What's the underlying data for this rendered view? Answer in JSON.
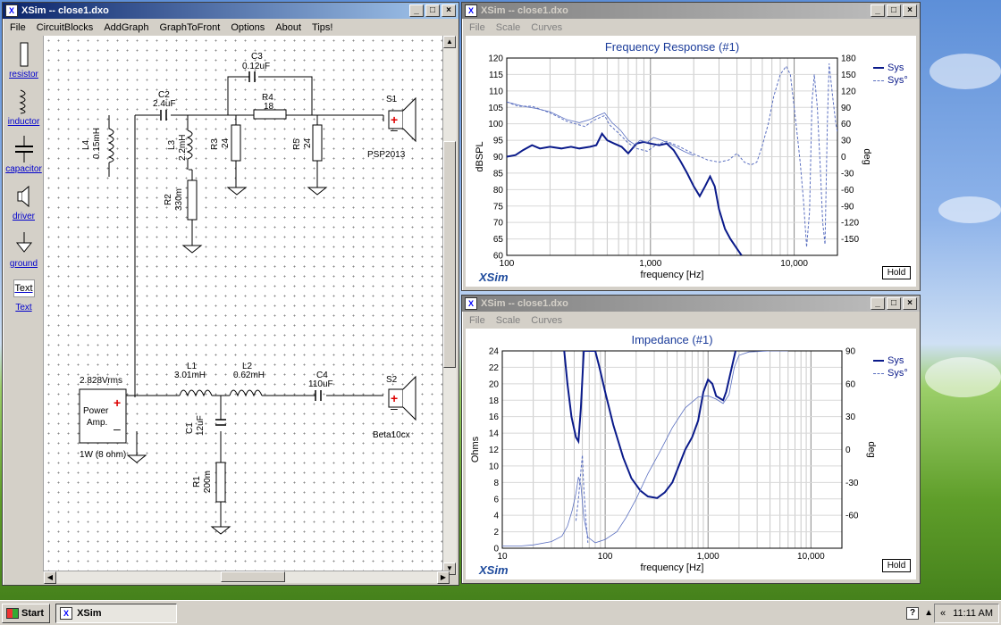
{
  "schematic_window": {
    "title": "XSim -- close1.dxo",
    "menu": [
      "File",
      "CircuitBlocks",
      "AddGraph",
      "GraphToFront",
      "Options",
      "About",
      "Tips!"
    ],
    "tools": [
      {
        "label": "resistor",
        "icon": "resistor-icon"
      },
      {
        "label": "inductor",
        "icon": "inductor-icon"
      },
      {
        "label": "capacitor",
        "icon": "capacitor-icon"
      },
      {
        "label": "driver",
        "icon": "speaker-icon"
      },
      {
        "label": "ground",
        "icon": "ground-icon"
      },
      {
        "label": "Text",
        "icon": "text-icon",
        "icon_text": "Text"
      }
    ],
    "components": {
      "L4": {
        "name": "L4",
        "value": "0.15mH"
      },
      "C2": {
        "name": "C2",
        "value": "2.4uF"
      },
      "C3": {
        "name": "C3",
        "value": "0.12uF"
      },
      "R4": {
        "name": "R4",
        "value": "18"
      },
      "L3": {
        "name": "L3",
        "value": "2.2mH"
      },
      "R3": {
        "name": "R3",
        "value": "24"
      },
      "R5": {
        "name": "R5",
        "value": "24"
      },
      "R2": {
        "name": "R2",
        "value": "330m"
      },
      "S1": {
        "name": "S1",
        "value": "PSP2013"
      },
      "L1": {
        "name": "L1",
        "value": "3.01mH"
      },
      "L2": {
        "name": "L2",
        "value": "0.62mH"
      },
      "C4": {
        "name": "C4",
        "value": "110uF"
      },
      "S2": {
        "name": "S2",
        "value": "Beta10cx"
      },
      "C1": {
        "name": "C1",
        "value": "12uF"
      },
      "R1": {
        "name": "R1",
        "value": "200m"
      },
      "amp": {
        "line1": "Power",
        "line2": "Amp.",
        "voltage": "2.828Vrms",
        "power": "1W (8 ohm)"
      }
    }
  },
  "freq_window": {
    "title": "XSim -- close1.dxo",
    "menu": [
      "File",
      "Scale",
      "Curves"
    ],
    "hold_label": "Hold",
    "brand": "XSim"
  },
  "imp_window": {
    "title": "XSim -- close1.dxo",
    "menu": [
      "File",
      "Scale",
      "Curves"
    ],
    "hold_label": "Hold",
    "brand": "XSim"
  },
  "chart_data": [
    {
      "type": "line",
      "title": "Frequency Response (#1)",
      "xlabel": "frequency [Hz]",
      "ylabel": "dBSPL",
      "y2label": "deg",
      "xscale": "log",
      "xlim": [
        100,
        20000
      ],
      "ylim": [
        60,
        120
      ],
      "y2lim": [
        -180,
        180
      ],
      "xticks": [
        100,
        1000,
        10000
      ],
      "xtick_labels": [
        "100",
        "1,000",
        "10,000"
      ],
      "yticks": [
        60,
        65,
        70,
        75,
        80,
        85,
        90,
        95,
        100,
        105,
        110,
        115,
        120
      ],
      "y2ticks": [
        -150,
        -120,
        -90,
        -60,
        -30,
        0,
        30,
        60,
        90,
        120,
        150,
        180
      ],
      "grid": true,
      "legend_position": "right",
      "series": [
        {
          "name": "Sys",
          "axis": "left",
          "style": "solid",
          "points": [
            [
              100,
              90
            ],
            [
              115,
              90.5
            ],
            [
              130,
              92
            ],
            [
              150,
              93.5
            ],
            [
              170,
              92.5
            ],
            [
              200,
              93
            ],
            [
              240,
              92.5
            ],
            [
              280,
              93
            ],
            [
              320,
              92.5
            ],
            [
              380,
              93
            ],
            [
              420,
              93.5
            ],
            [
              460,
              97
            ],
            [
              500,
              95
            ],
            [
              560,
              94
            ],
            [
              630,
              93
            ],
            [
              700,
              91
            ],
            [
              800,
              94
            ],
            [
              900,
              94.5
            ],
            [
              1000,
              94
            ],
            [
              1150,
              93.5
            ],
            [
              1300,
              94
            ],
            [
              1450,
              92
            ],
            [
              1600,
              89
            ],
            [
              1800,
              85
            ],
            [
              2000,
              81
            ],
            [
              2200,
              78
            ],
            [
              2400,
              81
            ],
            [
              2600,
              84
            ],
            [
              2800,
              81
            ],
            [
              3000,
              74
            ],
            [
              3300,
              68
            ],
            [
              3600,
              65
            ],
            [
              4000,
              62
            ],
            [
              4300,
              60
            ]
          ]
        },
        {
          "name": "Sys°",
          "axis": "right",
          "style": "dashed",
          "points": [
            [
              100,
              100
            ],
            [
              120,
              92
            ],
            [
              150,
              92
            ],
            [
              200,
              80
            ],
            [
              260,
              65
            ],
            [
              300,
              60
            ],
            [
              350,
              55
            ],
            [
              400,
              66
            ],
            [
              450,
              72
            ],
            [
              480,
              75
            ],
            [
              520,
              58
            ],
            [
              600,
              43
            ],
            [
              700,
              25
            ],
            [
              800,
              15
            ],
            [
              950,
              10
            ],
            [
              1100,
              22
            ],
            [
              1300,
              28
            ],
            [
              1600,
              18
            ],
            [
              2000,
              5
            ],
            [
              2500,
              -6
            ],
            [
              3000,
              -10
            ],
            [
              3500,
              -6
            ],
            [
              4000,
              6
            ],
            [
              4500,
              -10
            ],
            [
              5000,
              -15
            ],
            [
              5500,
              -10
            ],
            [
              6000,
              20
            ],
            [
              6600,
              60
            ],
            [
              7200,
              110
            ],
            [
              8000,
              150
            ],
            [
              8800,
              165
            ],
            [
              9400,
              150
            ],
            [
              10000,
              90
            ],
            [
              10600,
              30
            ],
            [
              11000,
              -10
            ],
            [
              11600,
              -80
            ],
            [
              12200,
              -165
            ],
            [
              12800,
              -100
            ],
            [
              13300,
              100
            ],
            [
              13800,
              150
            ],
            [
              14500,
              90
            ],
            [
              15200,
              -20
            ],
            [
              15800,
              -120
            ],
            [
              16400,
              -160
            ],
            [
              17000,
              60
            ],
            [
              17500,
              170
            ],
            [
              18500,
              110
            ],
            [
              19500,
              60
            ],
            [
              20000,
              45
            ]
          ]
        },
        {
          "name": "",
          "axis": "right",
          "style": "thin",
          "points": [
            [
              100,
              100
            ],
            [
              130,
              92
            ],
            [
              160,
              88
            ],
            [
              200,
              82
            ],
            [
              260,
              68
            ],
            [
              320,
              62
            ],
            [
              380,
              68
            ],
            [
              430,
              75
            ],
            [
              480,
              80
            ],
            [
              540,
              62
            ],
            [
              620,
              48
            ],
            [
              700,
              30
            ],
            [
              780,
              22
            ],
            [
              850,
              30
            ],
            [
              950,
              26
            ],
            [
              1050,
              35
            ],
            [
              1200,
              30
            ],
            [
              1400,
              22
            ],
            [
              1700,
              10
            ],
            [
              2000,
              2
            ]
          ]
        }
      ]
    },
    {
      "type": "line",
      "title": "Impedance (#1)",
      "xlabel": "frequency [Hz]",
      "ylabel": "Ohms",
      "y2label": "deg",
      "xscale": "log",
      "xlim": [
        10,
        20000
      ],
      "ylim": [
        0,
        24
      ],
      "y2lim": [
        -90,
        90
      ],
      "xticks": [
        10,
        100,
        1000,
        10000
      ],
      "xtick_labels": [
        "10",
        "100",
        "1,000",
        "10,000"
      ],
      "yticks": [
        0,
        2,
        4,
        6,
        8,
        10,
        12,
        14,
        16,
        18,
        20,
        22,
        24
      ],
      "y2ticks": [
        -60,
        -30,
        0,
        30,
        60,
        90
      ],
      "grid": true,
      "legend_position": "right",
      "series": [
        {
          "name": "Sys",
          "axis": "left",
          "style": "solid",
          "points": [
            [
              40,
              24
            ],
            [
              43,
              20
            ],
            [
              47,
              16
            ],
            [
              52,
              13.5
            ],
            [
              55,
              13
            ],
            [
              58,
              17
            ],
            [
              62,
              24
            ],
            [
              80,
              24
            ],
            [
              88,
              22
            ],
            [
              100,
              19
            ],
            [
              120,
              15
            ],
            [
              150,
              11
            ],
            [
              180,
              8.5
            ],
            [
              220,
              7
            ],
            [
              260,
              6.3
            ],
            [
              320,
              6.1
            ],
            [
              380,
              6.8
            ],
            [
              450,
              8
            ],
            [
              520,
              10
            ],
            [
              600,
              12
            ],
            [
              700,
              13.5
            ],
            [
              800,
              15.5
            ],
            [
              900,
              19
            ],
            [
              1000,
              20.5
            ],
            [
              1100,
              20
            ],
            [
              1200,
              18.5
            ],
            [
              1400,
              18
            ],
            [
              1500,
              19
            ],
            [
              1700,
              22
            ],
            [
              1850,
              24
            ]
          ]
        },
        {
          "name": "Sys°",
          "axis": "right",
          "style": "dashed",
          "points": [
            [
              52,
              -65
            ],
            [
              55,
              -45
            ],
            [
              58,
              -20
            ],
            [
              60,
              -5
            ],
            [
              62,
              -35
            ],
            [
              65,
              -65
            ],
            [
              68,
              -85
            ]
          ]
        },
        {
          "name": "",
          "axis": "right",
          "style": "thin",
          "points": [
            [
              10,
              -88
            ],
            [
              15,
              -88
            ],
            [
              20,
              -87
            ],
            [
              30,
              -84
            ],
            [
              38,
              -79
            ],
            [
              43,
              -70
            ],
            [
              48,
              -55
            ],
            [
              52,
              -40
            ],
            [
              55,
              -25
            ],
            [
              58,
              -32
            ],
            [
              62,
              -62
            ],
            [
              68,
              -80
            ],
            [
              80,
              -85
            ],
            [
              100,
              -82
            ],
            [
              130,
              -75
            ],
            [
              160,
              -62
            ],
            [
              200,
              -45
            ],
            [
              260,
              -22
            ],
            [
              340,
              -2
            ],
            [
              450,
              20
            ],
            [
              600,
              38
            ],
            [
              800,
              48
            ],
            [
              1000,
              49
            ],
            [
              1200,
              46
            ],
            [
              1400,
              42
            ],
            [
              1600,
              50
            ],
            [
              1800,
              75
            ],
            [
              2000,
              86
            ],
            [
              2500,
              89
            ],
            [
              4000,
              90
            ],
            [
              6000,
              90
            ]
          ]
        }
      ]
    }
  ],
  "taskbar": {
    "start_label": "Start",
    "app_label": "XSim",
    "clock": "11:11 AM"
  }
}
